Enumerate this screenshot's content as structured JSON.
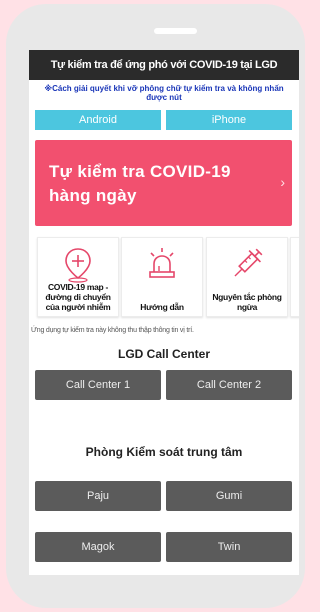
{
  "page": {
    "title": "Tự kiểm tra để ứng phó với COVID-19 tại LGD",
    "notice": "※Cách giải quyết khi vỡ phông chữ tự kiểm tra và không nhấn được nút"
  },
  "os_buttons": {
    "android": "Android",
    "iphone": "iPhone"
  },
  "hero": {
    "label": "Tự kiểm tra COVID-19 hàng ngày",
    "arrow": "›"
  },
  "cards": [
    {
      "label": "COVID-19 map - đường di chuyển của người nhiễm",
      "icon": "map-pin-plus-icon"
    },
    {
      "label": "Hướng dẫn",
      "icon": "siren-alarm-icon"
    },
    {
      "label": "Nguyên tắc phòng ngừa",
      "icon": "syringe-icon"
    }
  ],
  "location_note": "Ứng dụng tự kiểm tra này không thu thập thông tin vị trí.",
  "call_center": {
    "title": "LGD Call Center",
    "buttons": [
      "Call Center 1",
      "Call Center 2"
    ]
  },
  "control_room": {
    "title": "Phòng Kiểm soát trung tâm",
    "buttons": [
      "Paju",
      "Gumi",
      "Magok",
      "Twin"
    ]
  },
  "colors": {
    "background": "#ffe1e6",
    "accent_pink": "#f2506f",
    "os_button": "#4cc6df",
    "title_bar": "#2b2b2b",
    "notice_text": "#1a36b8",
    "gray_button": "#5b5b5b"
  }
}
